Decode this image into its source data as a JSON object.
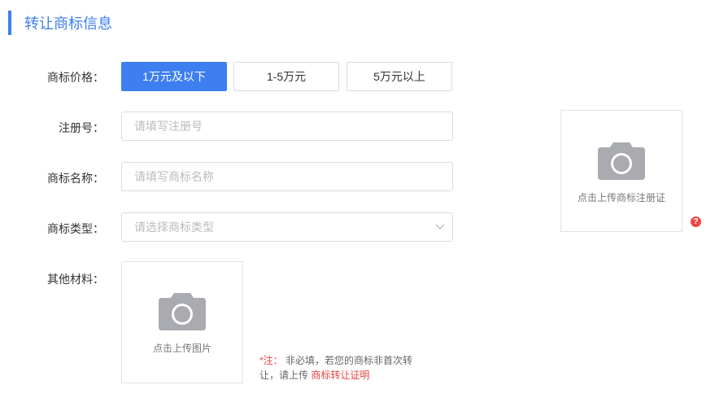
{
  "section": {
    "title": "转让商标信息"
  },
  "labels": {
    "price": "商标价格：",
    "reg_no": "注册号：",
    "name": "商标名称：",
    "type": "商标类型：",
    "other": "其他材料："
  },
  "price_options": [
    {
      "label": "1万元及以下",
      "selected": true
    },
    {
      "label": "1-5万元",
      "selected": false
    },
    {
      "label": "5万元以上",
      "selected": false
    }
  ],
  "fields": {
    "reg_no": {
      "value": "",
      "placeholder": "请填写注册号"
    },
    "name": {
      "value": "",
      "placeholder": "请填写商标名称"
    },
    "type": {
      "value": "",
      "placeholder": "请选择商标类型"
    }
  },
  "uploads": {
    "certificate": {
      "text": "点击上传商标注册证",
      "icon": "camera-icon"
    },
    "other": {
      "text": "点击上传图片",
      "icon": "camera-icon"
    }
  },
  "help": {
    "symbol": "?"
  },
  "note": {
    "prefix": "*注：",
    "text": " 非必填，若您的商标非首次转让，请上传 ",
    "link": "商标转让证明"
  },
  "colors": {
    "accent": "#3d7ff0",
    "warning": "#e94040",
    "icon_gray": "#a9abb0"
  }
}
